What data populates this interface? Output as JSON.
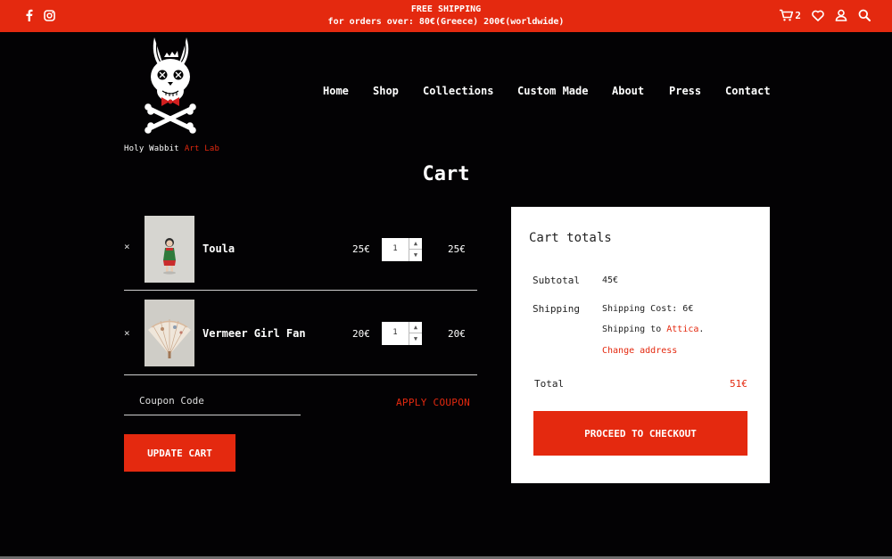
{
  "topbar": {
    "shipping_title": "FREE SHIPPING",
    "shipping_details": "for orders over: 80€(Greece) 200€(worldwide)",
    "cart_count": "2",
    "icons": [
      "facebook-icon",
      "instagram-icon",
      "cart-icon",
      "heart-icon",
      "user-icon",
      "search-icon"
    ]
  },
  "brand": {
    "name": "Holy Wabbit",
    "accent": "Art Lab"
  },
  "nav": [
    "Home",
    "Shop",
    "Collections",
    "Custom Made",
    "About",
    "Press",
    "Contact"
  ],
  "page_title": "Cart",
  "cart": {
    "items": [
      {
        "name": "Toula",
        "price": "25€",
        "qty": "1",
        "subtotal": "25€"
      },
      {
        "name": "Vermeer Girl Fan",
        "price": "20€",
        "qty": "1",
        "subtotal": "20€"
      }
    ],
    "remove_symbol": "×",
    "coupon_placeholder": "Coupon Code",
    "apply_label": "APPLY COUPON",
    "update_label": "UPDATE CART"
  },
  "totals": {
    "title": "Cart totals",
    "subtotal_label": "Subtotal",
    "subtotal_value": "45€",
    "shipping_label": "Shipping",
    "shipping_cost": "Shipping Cost: 6€",
    "shipping_to_prefix": "Shipping to",
    "shipping_to_place": "Attica",
    "shipping_to_suffix": ".",
    "change_address": "Change address",
    "total_label": "Total",
    "total_value": "51€",
    "checkout_label": "PROCEED TO CHECKOUT"
  },
  "colors": {
    "accent": "#e4290f",
    "background": "#030204",
    "panel": "#ffffff"
  }
}
